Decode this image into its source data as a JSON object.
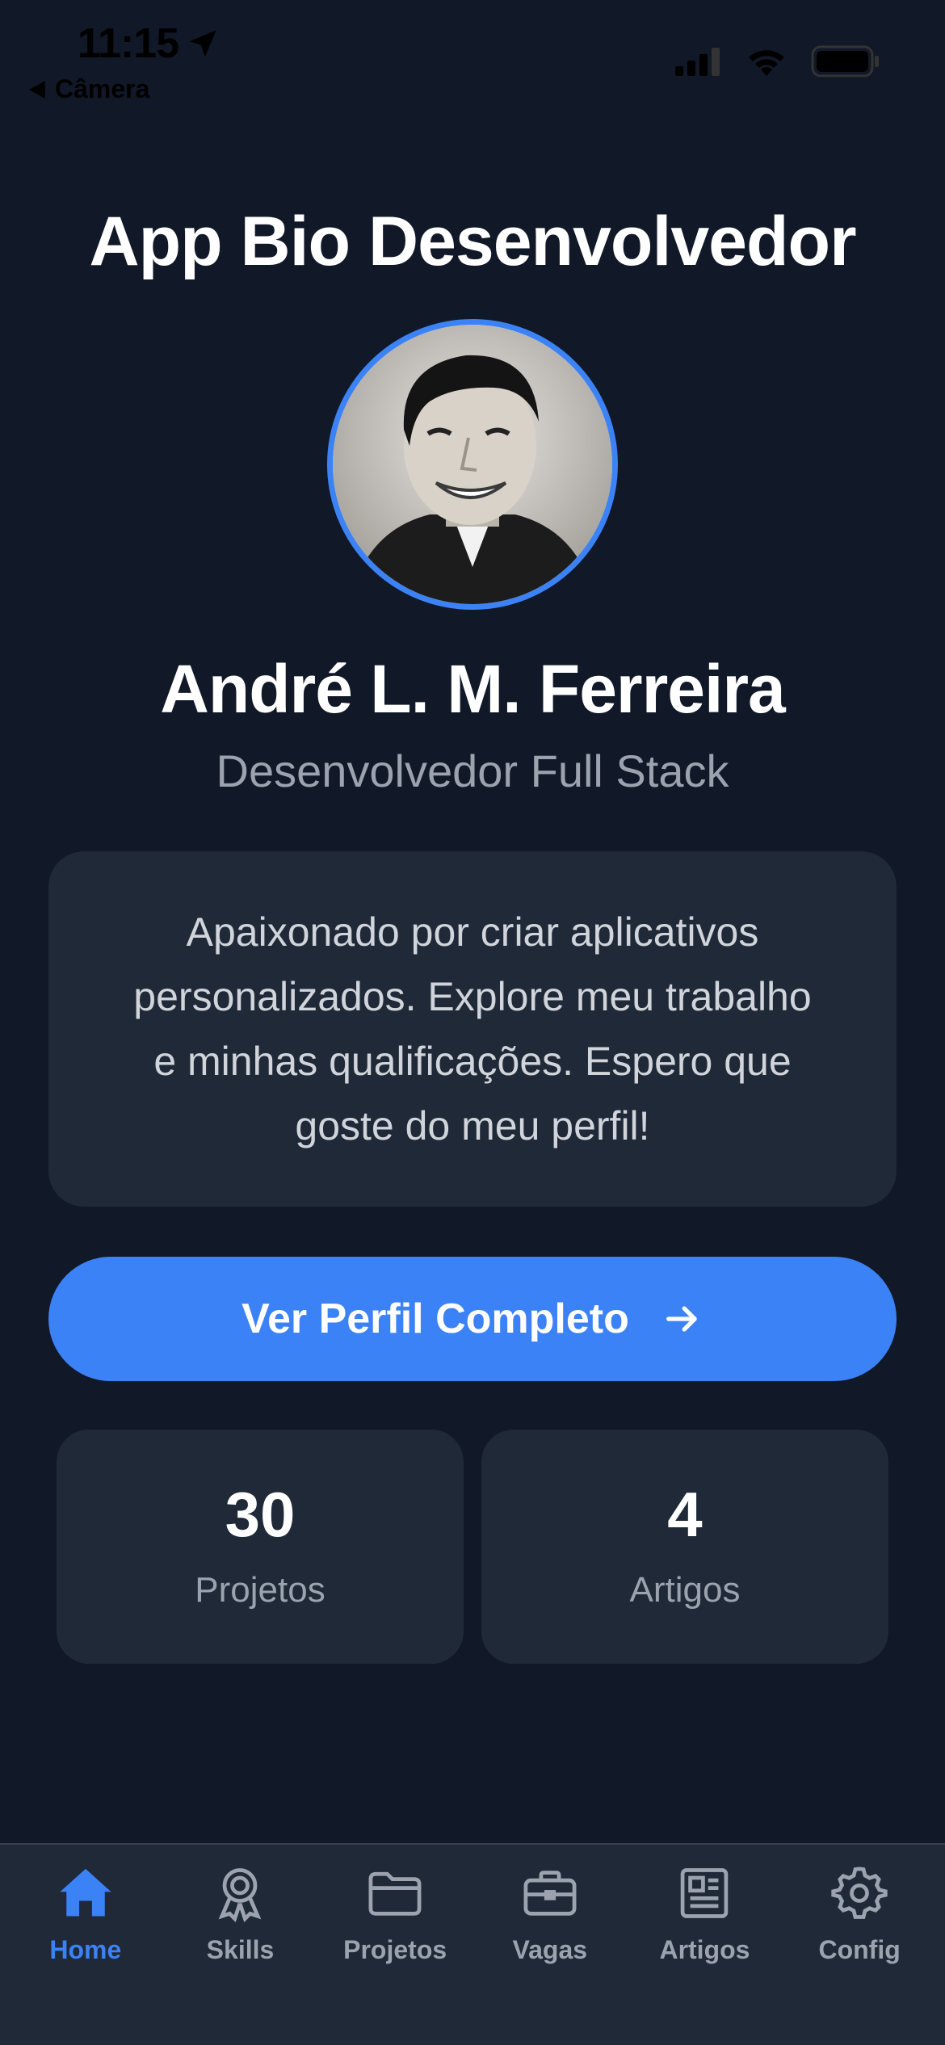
{
  "status_bar": {
    "time": "11:15",
    "back_label": "Câmera"
  },
  "header": {
    "title": "App Bio Desenvolvedor"
  },
  "profile": {
    "name": "André L. M. Ferreira",
    "role": "Desenvolvedor Full Stack",
    "bio": "Apaixonado por criar aplicativos personalizados. Explore meu trabalho e minhas qualificações. Espero que goste do meu perfil!"
  },
  "cta": {
    "label": "Ver Perfil Completo",
    "icon": "arrow-right-icon"
  },
  "stats": [
    {
      "value": "30",
      "label": "Projetos"
    },
    {
      "value": "4",
      "label": "Artigos"
    }
  ],
  "tabbar": {
    "items": [
      {
        "label": "Home",
        "icon": "home-icon",
        "active": true
      },
      {
        "label": "Skills",
        "icon": "award-icon",
        "active": false
      },
      {
        "label": "Projetos",
        "icon": "folder-icon",
        "active": false
      },
      {
        "label": "Vagas",
        "icon": "briefcase-icon",
        "active": false
      },
      {
        "label": "Artigos",
        "icon": "newspaper-icon",
        "active": false
      },
      {
        "label": "Config",
        "icon": "gear-icon",
        "active": false
      }
    ]
  },
  "colors": {
    "background": "#111827",
    "card": "#1f2937",
    "accent": "#3b82f6",
    "muted_text": "#9ca3af"
  }
}
